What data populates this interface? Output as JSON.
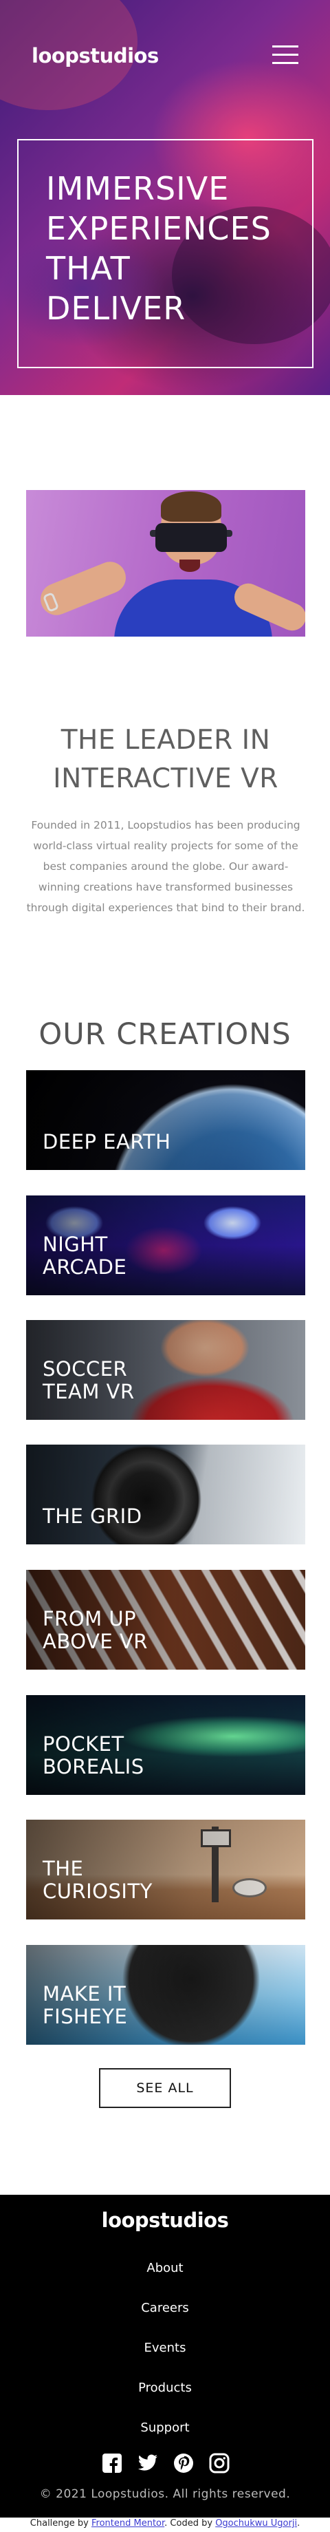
{
  "header": {
    "logo": "loopstudios",
    "menu_icon": "hamburger-icon"
  },
  "hero": {
    "headline": "Immersive experiences that deliver"
  },
  "about": {
    "title": "The leader in interactive VR",
    "body": "Founded in 2011, Loopstudios has been producing world-class virtual reality projects for some of the best companies around the globe. Our award-winning creations have transformed businesses through digital experiences that bind to their brand."
  },
  "creations": {
    "title": "Our creations",
    "items": [
      {
        "label": "Deep earth"
      },
      {
        "label": "Night arcade"
      },
      {
        "label": "Soccer team VR"
      },
      {
        "label": "The grid"
      },
      {
        "label": "From up above VR"
      },
      {
        "label": "Pocket borealis"
      },
      {
        "label": "The curiosity"
      },
      {
        "label": "Make it fisheye"
      }
    ],
    "see_all": "See all"
  },
  "footer": {
    "logo": "loopstudios",
    "nav": [
      "About",
      "Careers",
      "Events",
      "Products",
      "Support"
    ],
    "social_icons": [
      "facebook-icon",
      "twitter-icon",
      "pinterest-icon",
      "instagram-icon"
    ],
    "copyright": "© 2021 Loopstudios. All rights reserved."
  },
  "attribution": {
    "prefix": "Challenge by",
    "challenge_link": "Frontend Mentor",
    "middle": ". Coded by",
    "author_link": "Ogochukwu Ugorji",
    "suffix": "."
  },
  "colors": {
    "footer_bg": "#000000",
    "heading_gray": "#5f5f5f",
    "body_gray": "#888888",
    "link_blue": "#3b3bd1"
  }
}
